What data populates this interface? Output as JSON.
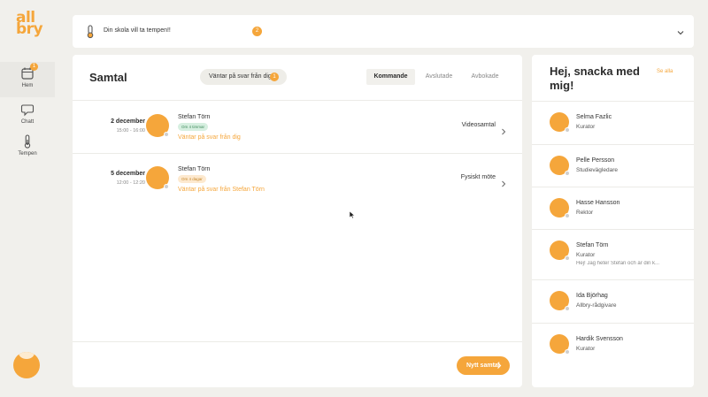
{
  "brand": {
    "logo_line1": "all",
    "logo_line2": "bry",
    "accent": "#f5a63b"
  },
  "nav": [
    {
      "label": "Hem",
      "icon": "calendar-icon",
      "badge": "1",
      "active": true
    },
    {
      "label": "Chatt",
      "icon": "chat-icon",
      "active": false
    },
    {
      "label": "Tempen",
      "icon": "thermometer-icon",
      "active": false
    }
  ],
  "banner": {
    "text": "Din skola vill ta tempen!!",
    "badge": "2"
  },
  "main": {
    "title": "Samtal",
    "pending_label": "Väntar på svar från dig",
    "pending_badge": "1",
    "tabs": [
      "Kommande",
      "Avslutade",
      "Avbokade"
    ],
    "active_tab": "Kommande",
    "appointments": [
      {
        "date": "2 december",
        "time": "15:00 - 16:00",
        "name": "Stefan Törn",
        "tag": "Om 4 timmar",
        "status": "Väntar på svar från dig",
        "type": "Videosamtal"
      },
      {
        "date": "5 december",
        "time": "12:00 - 12:20",
        "name": "Stefan Törn",
        "tag": "Om 4 dagar",
        "status": "Väntar på svar från Stefan Törn",
        "type": "Fysiskt möte"
      }
    ],
    "new_button": "Nytt samtal"
  },
  "side": {
    "title": "Hej, snacka med mig!",
    "link": "Se alla",
    "contacts": [
      {
        "name": "Selma Fazlic",
        "role": "Kurator",
        "message": ""
      },
      {
        "name": "Pelle Persson",
        "role": "Studievägledare",
        "message": ""
      },
      {
        "name": "Hasse Hansson",
        "role": "Rektor",
        "message": ""
      },
      {
        "name": "Stefan Törn",
        "role": "Kurator",
        "message": "Hej! Jag heter Stefan och är din k..."
      },
      {
        "name": "Ida Björhag",
        "role": "Allbry-rådgivare",
        "message": ""
      },
      {
        "name": "Hardik Svensson",
        "role": "Kurator",
        "message": ""
      }
    ]
  }
}
